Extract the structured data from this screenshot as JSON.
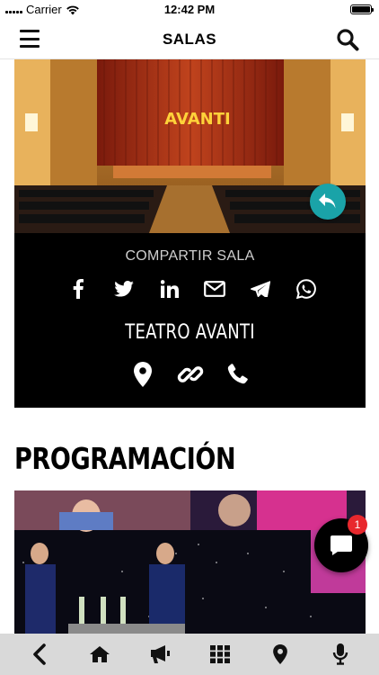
{
  "status_bar": {
    "carrier": "Carrier",
    "time": "12:42 PM",
    "battery_level": 1.0
  },
  "header": {
    "title": "SALAS",
    "menu_icon": "hamburger-menu-icon",
    "search_icon": "search-icon"
  },
  "hall": {
    "image_text": "AVANTI",
    "share_label": "COMPARTIR SALA",
    "share_icons": [
      "facebook-icon",
      "twitter-icon",
      "linkedin-icon",
      "email-icon",
      "telegram-icon",
      "whatsapp-icon"
    ],
    "name": "TEATRO AVANTI",
    "contact_icons": [
      "location-pin-icon",
      "link-icon",
      "phone-icon"
    ],
    "back_button_icon": "reply-icon"
  },
  "programacion": {
    "title": "PROGRAMACIÓN"
  },
  "chat": {
    "icon": "chat-bubble-icon",
    "badge_count": "1"
  },
  "bottom_nav": {
    "items": [
      "back-chevron-icon",
      "home-icon",
      "megaphone-icon",
      "grid-icon",
      "location-pin-icon",
      "microphone-icon"
    ]
  },
  "colors": {
    "accent_teal": "#1aa3a8",
    "badge_red": "#e8282d",
    "card_black": "#000000",
    "nav_grey": "#d9d9d9"
  }
}
